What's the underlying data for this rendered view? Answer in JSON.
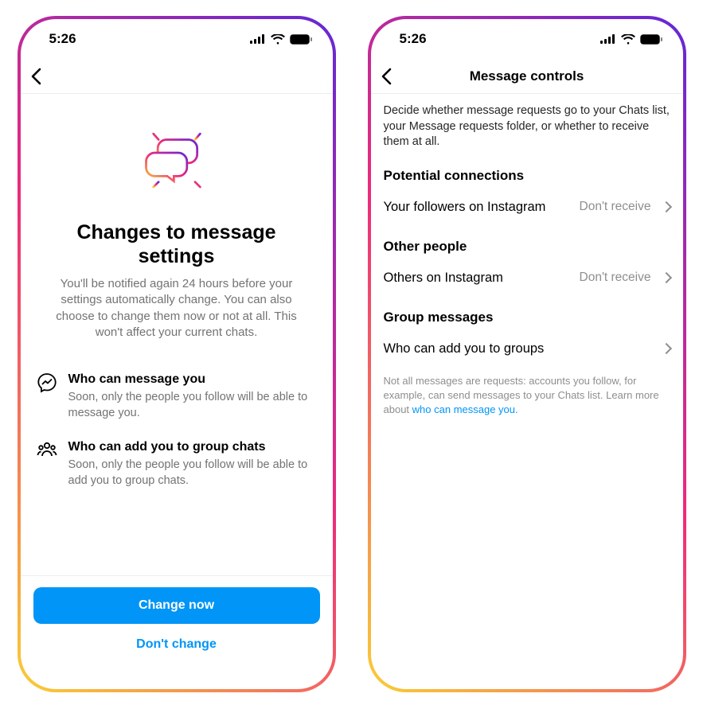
{
  "status": {
    "time": "5:26"
  },
  "screen1": {
    "title": "Changes to message settings",
    "body": "You'll be notified again 24 hours before your settings automatically change. You can also choose to change them now or not at all. This won't affect your current chats.",
    "rows": [
      {
        "icon": "messenger-icon",
        "title": "Who can message you",
        "subtitle": "Soon, only the people you follow will be able to message you."
      },
      {
        "icon": "group-icon",
        "title": "Who can add you to group chats",
        "subtitle": "Soon, only the people you follow will be able to add you to group chats."
      }
    ],
    "primary": "Change now",
    "secondary": "Don't change"
  },
  "screen2": {
    "nav_title": "Message controls",
    "description": "Decide whether message requests go to your Chats list, your Message requests folder, or whether to receive them at all.",
    "sections": [
      {
        "heading": "Potential connections",
        "items": [
          {
            "label": "Your followers on Instagram",
            "value": "Don't receive"
          }
        ]
      },
      {
        "heading": "Other people",
        "items": [
          {
            "label": "Others on Instagram",
            "value": "Don't receive"
          }
        ]
      },
      {
        "heading": "Group messages",
        "items": [
          {
            "label": "Who can add you to groups",
            "value": ""
          }
        ]
      }
    ],
    "footnote_prefix": "Not all messages are requests: accounts you follow, for example, can send messages to your Chats list. Learn more about ",
    "footnote_link": "who can message you."
  }
}
